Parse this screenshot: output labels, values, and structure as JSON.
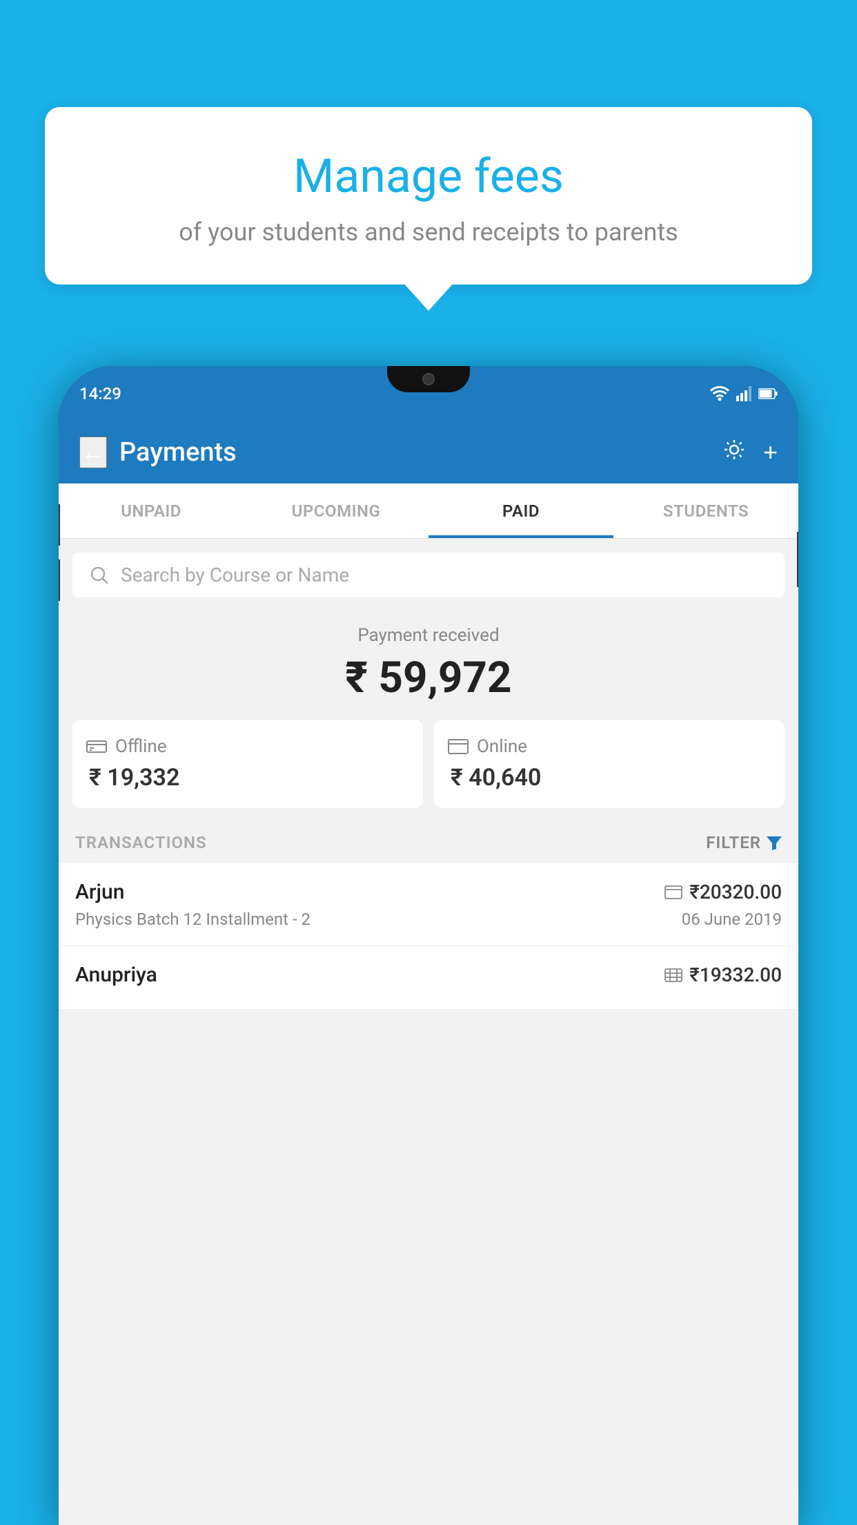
{
  "page": {
    "background_color": "#1ab0e8"
  },
  "bubble": {
    "title": "Manage fees",
    "subtitle": "of your students and send receipts to parents"
  },
  "status_bar": {
    "time": "14:29",
    "wifi": "▼",
    "signal": "▲",
    "battery": "▪"
  },
  "header": {
    "title": "Payments",
    "back_label": "←",
    "gear_label": "⚙",
    "plus_label": "+"
  },
  "tabs": [
    {
      "id": "unpaid",
      "label": "UNPAID",
      "active": false
    },
    {
      "id": "upcoming",
      "label": "UPCOMING",
      "active": false
    },
    {
      "id": "paid",
      "label": "PAID",
      "active": true
    },
    {
      "id": "students",
      "label": "STUDENTS",
      "active": false
    }
  ],
  "search": {
    "placeholder": "Search by Course or Name"
  },
  "payment_summary": {
    "label": "Payment received",
    "amount": "₹ 59,972"
  },
  "payment_methods": [
    {
      "id": "offline",
      "icon": "💳",
      "label": "Offline",
      "amount": "₹ 19,332"
    },
    {
      "id": "online",
      "icon": "💳",
      "label": "Online",
      "amount": "₹ 40,640"
    }
  ],
  "transactions": {
    "header_label": "TRANSACTIONS",
    "filter_label": "FILTER",
    "rows": [
      {
        "name": "Arjun",
        "payment_icon": "💳",
        "amount": "₹20320.00",
        "course": "Physics Batch 12 Installment - 2",
        "date": "06 June 2019"
      },
      {
        "name": "Anupriya",
        "payment_icon": "🏧",
        "amount": "₹19332.00",
        "course": "",
        "date": ""
      }
    ]
  }
}
